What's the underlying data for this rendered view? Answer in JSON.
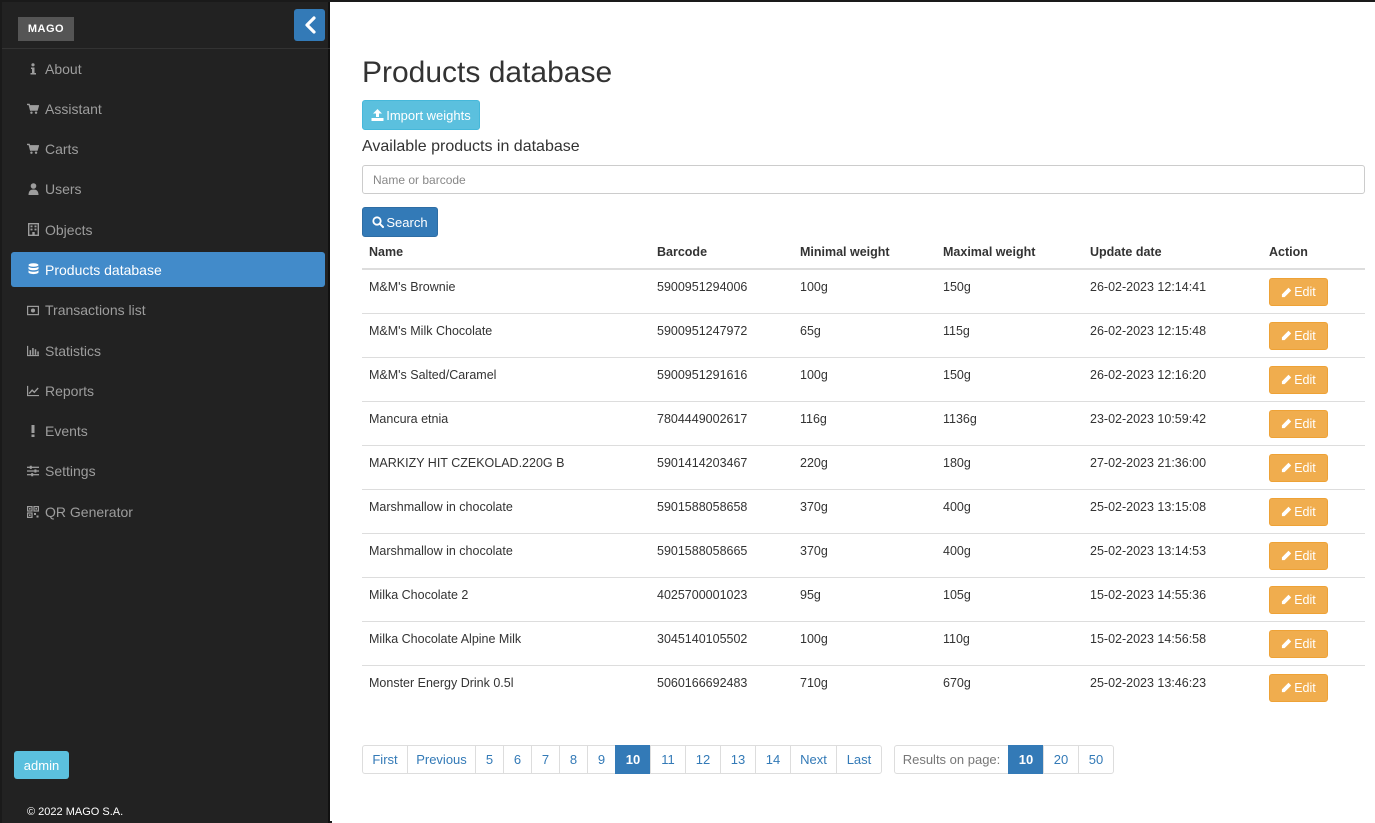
{
  "sidebar": {
    "logo": "MAGO",
    "items": [
      {
        "label": "About",
        "icon": "info-icon",
        "active": false
      },
      {
        "label": "Assistant",
        "icon": "cart-icon",
        "active": false
      },
      {
        "label": "Carts",
        "icon": "cart-icon",
        "active": false
      },
      {
        "label": "Users",
        "icon": "user-icon",
        "active": false
      },
      {
        "label": "Objects",
        "icon": "building-icon",
        "active": false
      },
      {
        "label": "Products database",
        "icon": "database-icon",
        "active": true
      },
      {
        "label": "Transactions list",
        "icon": "money-icon",
        "active": false
      },
      {
        "label": "Statistics",
        "icon": "bar-chart-icon",
        "active": false
      },
      {
        "label": "Reports",
        "icon": "line-chart-icon",
        "active": false
      },
      {
        "label": "Events",
        "icon": "exclamation-icon",
        "active": false
      },
      {
        "label": "Settings",
        "icon": "sliders-icon",
        "active": false
      },
      {
        "label": "QR Generator",
        "icon": "qrcode-icon",
        "active": false
      }
    ],
    "admin_label": "admin",
    "copyright": "© 2022 MAGO S.A."
  },
  "main": {
    "title": "Products database",
    "import_label": "Import weights",
    "subtitle": "Available products in database",
    "search_placeholder": "Name or barcode",
    "search_label": "Search",
    "columns": [
      "Name",
      "Barcode",
      "Minimal weight",
      "Maximal weight",
      "Update date",
      "Action"
    ],
    "rows": [
      {
        "name": "M&M's Brownie",
        "barcode": "5900951294006",
        "min": "100g",
        "max": "150g",
        "date": "26-02-2023 12:14:41"
      },
      {
        "name": "M&M's Milk Chocolate",
        "barcode": "5900951247972",
        "min": "65g",
        "max": "115g",
        "date": "26-02-2023 12:15:48"
      },
      {
        "name": "M&M's Salted/Caramel",
        "barcode": "5900951291616",
        "min": "100g",
        "max": "150g",
        "date": "26-02-2023 12:16:20"
      },
      {
        "name": "Mancura etnia",
        "barcode": "7804449002617",
        "min": "116g",
        "max": "1136g",
        "date": "23-02-2023 10:59:42"
      },
      {
        "name": "MARKIZY HIT CZEKOLAD.220G B",
        "barcode": "5901414203467",
        "min": "220g",
        "max": "180g",
        "date": "27-02-2023 21:36:00"
      },
      {
        "name": "Marshmallow in chocolate",
        "barcode": "5901588058658",
        "min": "370g",
        "max": "400g",
        "date": "25-02-2023 13:15:08"
      },
      {
        "name": "Marshmallow in chocolate",
        "barcode": "5901588058665",
        "min": "370g",
        "max": "400g",
        "date": "25-02-2023 13:14:53"
      },
      {
        "name": "Milka Chocolate 2",
        "barcode": "4025700001023",
        "min": "95g",
        "max": "105g",
        "date": "15-02-2023 14:55:36"
      },
      {
        "name": "Milka Chocolate Alpine Milk",
        "barcode": "3045140105502",
        "min": "100g",
        "max": "110g",
        "date": "15-02-2023 14:56:58"
      },
      {
        "name": "Monster Energy Drink 0.5l",
        "barcode": "5060166692483",
        "min": "710g",
        "max": "670g",
        "date": "25-02-2023 13:46:23"
      }
    ],
    "edit_label": "Edit"
  },
  "pagination": {
    "pages": [
      {
        "label": "First",
        "active": false
      },
      {
        "label": "Previous",
        "active": false
      },
      {
        "label": "5",
        "active": false
      },
      {
        "label": "6",
        "active": false
      },
      {
        "label": "7",
        "active": false
      },
      {
        "label": "8",
        "active": false
      },
      {
        "label": "9",
        "active": false
      },
      {
        "label": "10",
        "active": true
      },
      {
        "label": "11",
        "active": false
      },
      {
        "label": "12",
        "active": false
      },
      {
        "label": "13",
        "active": false
      },
      {
        "label": "14",
        "active": false
      },
      {
        "label": "Next",
        "active": false
      },
      {
        "label": "Last",
        "active": false
      }
    ],
    "results_label": "Results on page:",
    "page_sizes": [
      {
        "label": "10",
        "active": true
      },
      {
        "label": "20",
        "active": false
      },
      {
        "label": "50",
        "active": false
      }
    ]
  },
  "colors": {
    "primary": "#337ab7",
    "info": "#5bc0de",
    "warning": "#f0ad4e",
    "sidebar_bg": "#222222",
    "active_nav": "#428bca"
  }
}
